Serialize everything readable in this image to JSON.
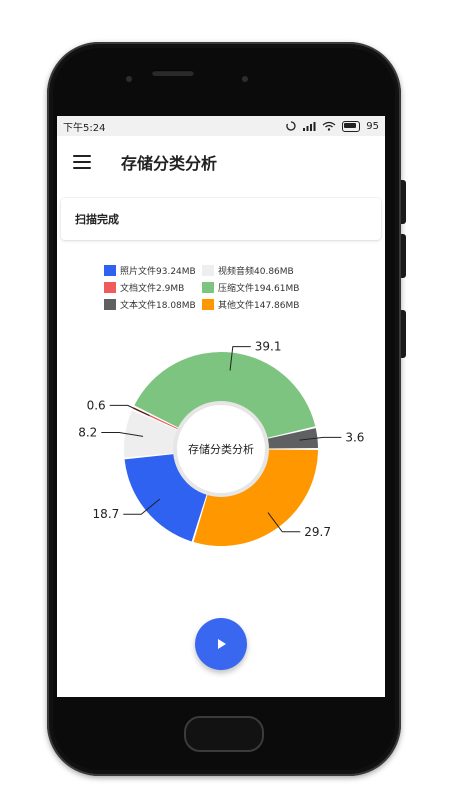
{
  "status_bar": {
    "time": "下午5:24",
    "battery": "95"
  },
  "app_bar": {
    "title": "存储分类分析",
    "menu_icon": "hamburger-menu-icon"
  },
  "scan_card": {
    "text": "扫描完成"
  },
  "legend": [
    {
      "label": "照片文件93.24MB",
      "color": "#2f62f0"
    },
    {
      "label": "视频音频40.86MB",
      "color": "#eeeeee"
    },
    {
      "label": "文档文件2.9MB",
      "color": "#f05c5c"
    },
    {
      "label": "压缩文件194.61MB",
      "color": "#7cc47f"
    },
    {
      "label": "文本文件18.08MB",
      "color": "#5f6062"
    },
    {
      "label": "其他文件147.86MB",
      "color": "#ff9800"
    }
  ],
  "chart_data": {
    "type": "pie",
    "center_label": "存储分类分析",
    "series": [
      {
        "name": "其他文件",
        "value": 29.7,
        "label": "29.7",
        "color": "#ff9800"
      },
      {
        "name": "照片文件",
        "value": 18.7,
        "label": "18.7",
        "color": "#2f62f0"
      },
      {
        "name": "视频音频",
        "value": 8.2,
        "label": "8.2",
        "color": "#eeeeee"
      },
      {
        "name": "文档文件",
        "value": 0.6,
        "label": "0.6",
        "color": "#f05c5c"
      },
      {
        "name": "压缩文件",
        "value": 39.1,
        "label": "39.1",
        "color": "#7cc47f"
      },
      {
        "name": "文本文件",
        "value": 3.6,
        "label": "3.6",
        "color": "#5f6062"
      }
    ]
  },
  "fab": {
    "icon": "play-icon"
  }
}
